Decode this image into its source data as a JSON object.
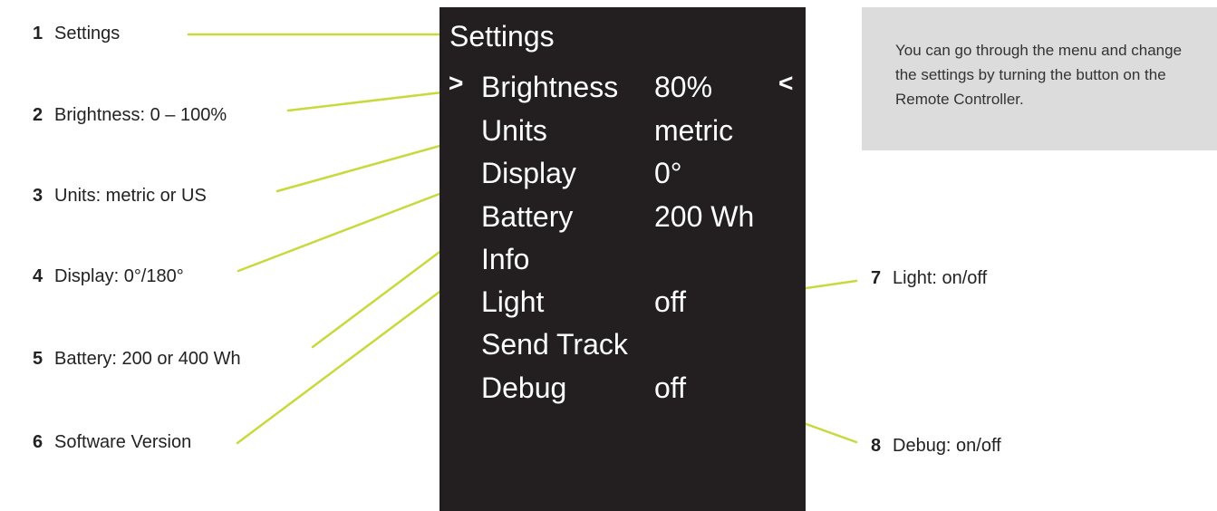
{
  "screen": {
    "title": "Settings",
    "cursor_left": ">",
    "cursor_right": "<",
    "items": [
      {
        "label": "Brightness",
        "value": "80%"
      },
      {
        "label": "Units",
        "value": "metric"
      },
      {
        "label": "Display",
        "value": "0°"
      },
      {
        "label": "Battery",
        "value": "200 Wh"
      },
      {
        "label": "Info",
        "value": ""
      },
      {
        "label": "Light",
        "value": "off"
      },
      {
        "label": "Send Track",
        "value": ""
      },
      {
        "label": "Debug",
        "value": "off"
      }
    ]
  },
  "callouts": [
    {
      "num": "1",
      "text": "Settings"
    },
    {
      "num": "2",
      "text": "Brightness: 0 – 100%"
    },
    {
      "num": "3",
      "text": "Units: metric or US"
    },
    {
      "num": "4",
      "text": "Display: 0°/180°"
    },
    {
      "num": "5",
      "text": "Battery: 200 or 400 Wh"
    },
    {
      "num": "6",
      "text": "Software Version"
    },
    {
      "num": "7",
      "text": "Light: on/off"
    },
    {
      "num": "8",
      "text": "Debug: on/off"
    }
  ],
  "note": {
    "text": "You can go through the menu and change the settings by turning the button on the Remote Controller."
  },
  "colors": {
    "screen_bg": "#231f20",
    "leader_line": "#c8d93c",
    "note_bg": "#dcdcdc"
  }
}
